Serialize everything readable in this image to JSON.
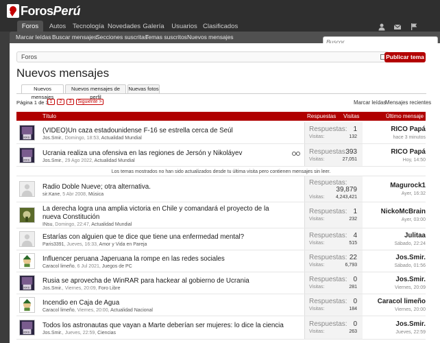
{
  "header": {
    "logo_text1": "Foros",
    "logo_text2": "Perú"
  },
  "nav": {
    "tabs": [
      "Foros",
      "Autos",
      "Tecnología",
      "Novedades",
      "Galería",
      "Usuarios",
      "Clasificados"
    ]
  },
  "subnav": [
    "Marcar leídas",
    "Buscar mensajes",
    "Secciones suscritas",
    "Temas suscritos",
    "Nuevos mensajes"
  ],
  "search": {
    "placeholder": "Buscor..."
  },
  "breadcrumb": "Foros",
  "new_topic_label": "Publicar tema",
  "page_title": "Nuevos mensajes",
  "tabs": [
    "Nuevos mensajes",
    "Nuevos mensajes de perfil",
    "Nuevas fotos"
  ],
  "pager": {
    "label": "Página 1 de 3",
    "pages": [
      "1",
      "2",
      "3"
    ],
    "next": "Siguiente >"
  },
  "right_links": [
    "Marcar leídas",
    "Mensajes recientes"
  ],
  "table_header": {
    "title": "Título",
    "replies": "Respuestas",
    "views": "Visitas",
    "last": "Último mensaje"
  },
  "stat_labels": {
    "replies": "Respuestas:",
    "views": "Visitas:"
  },
  "notice": "Los temas mostrados no han sido actualizados desde tu última visita pero contienen mensajes sin leer.",
  "threads": [
    {
      "title": "(VIDEO)Un caza estadounidense F-16 se estrella cerca de Seúl",
      "author": "Jos.Smir.",
      "date": "Domingo, 18:53",
      "forum": "Actualidad Mundial",
      "replies": "1",
      "views": "132",
      "last_user": "RICO Papá",
      "last_time": "hace 3 minutos"
    },
    {
      "title": "Ucrania realiza una ofensiva en las regiones de Jersón y Nikoláyev",
      "author": "Jos.Smir.",
      "date": "29 Ago 2022",
      "forum": "Actualidad Mundial",
      "replies": "393",
      "views": "27,051",
      "last_user": "RICO Papá",
      "last_time": "Hoy, 14:50"
    },
    {
      "title": "Radio Doble Nueve; otra alternativa.",
      "author": "sir.Kane",
      "date": "5 Abr 2008",
      "forum": "Música",
      "replies": "39,879",
      "views": "4,243,421",
      "last_user": "Magurock1",
      "last_time": "Ayer, 16:32"
    },
    {
      "title": "La derecha logra una amplia victoria en Chile y comandará el proyecto de la nueva Constitución",
      "author": "INsu",
      "date": "Domingo, 22:47",
      "forum": "Actualidad Mundial",
      "replies": "1",
      "views": "232",
      "last_user": "NickoMcBrain",
      "last_time": "Ayer, 03:00"
    },
    {
      "title": "Estarías con alguien que te dice que tiene una enfermedad mental?",
      "author": "Paris3391",
      "date": "Jueves, 16:33",
      "forum": "Amor y Vida en Pareja",
      "replies": "4",
      "views": "515",
      "last_user": "Julitaa",
      "last_time": "Sábado, 22:24"
    },
    {
      "title": "Influencer peruana Japeruana la rompe en las redes sociales",
      "author": "Caracol limeño",
      "date": "6 Jul 2021",
      "forum": "Juegos de PC",
      "replies": "22",
      "views": "6,793",
      "last_user": "Jos.Smir.",
      "last_time": "Sábado, 01:56"
    },
    {
      "title": "Rusia se aprovecha de WinRAR para hackear al gobierno de Ucrania",
      "author": "Jos.Smir.",
      "date": "Viernes, 20:09",
      "forum": "Foro Libre",
      "replies": "0",
      "views": "281",
      "last_user": "Jos.Smir.",
      "last_time": "Viernes, 20:09"
    },
    {
      "title": "Incendio en Caja de Agua",
      "author": "Caracol limeño",
      "date": "Viernes, 20:00",
      "forum": "Actualidad Nacional",
      "replies": "0",
      "views": "184",
      "last_user": "Caracol limeño",
      "last_time": "Viernes, 20:00"
    },
    {
      "title": "Todos los astronautas que vayan a Marte deberían ser mujeres: lo dice la ciencia",
      "author": "Jos.Smir.",
      "date": "Jueves, 22:59",
      "forum": "Ciencias",
      "replies": "0",
      "views": "263",
      "last_user": "Jos.Smir.",
      "last_time": "Jueves, 22:59"
    }
  ]
}
